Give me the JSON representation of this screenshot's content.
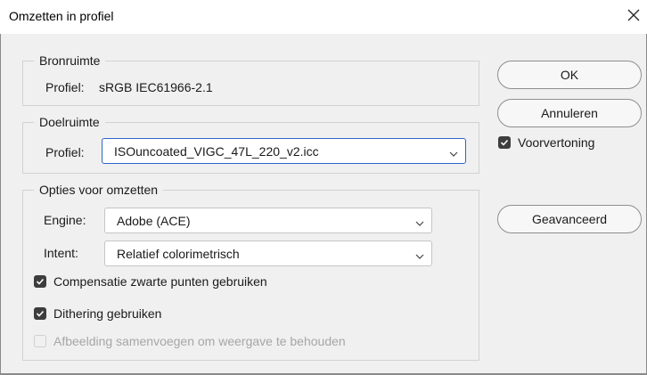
{
  "window": {
    "title": "Omzetten in profiel",
    "close_icon": "close-icon"
  },
  "source": {
    "legend": "Bronruimte",
    "profile_label": "Profiel:",
    "profile_value": "sRGB IEC61966-2.1"
  },
  "destination": {
    "legend": "Doelruimte",
    "profile_label": "Profiel:",
    "profile_value": "ISOuncoated_VIGC_47L_220_v2.icc"
  },
  "options": {
    "legend": "Opties voor omzetten",
    "engine_label": "Engine:",
    "engine_value": "Adobe (ACE)",
    "intent_label": "Intent:",
    "intent_value": "Relatief colorimetrisch",
    "black_point": {
      "label": "Compensatie zwarte punten gebruiken",
      "checked": true
    },
    "dither": {
      "label": "Dithering gebruiken",
      "checked": true
    },
    "flatten": {
      "label": "Afbeelding samenvoegen om weergave te behouden",
      "checked": false,
      "disabled": true
    }
  },
  "buttons": {
    "ok": "OK",
    "cancel": "Annuleren",
    "advanced": "Geavanceerd"
  },
  "preview": {
    "label": "Voorvertoning",
    "checked": true
  },
  "colors": {
    "accent_border": "#2e66c8",
    "checkbox_fill": "#3d3d3d"
  }
}
